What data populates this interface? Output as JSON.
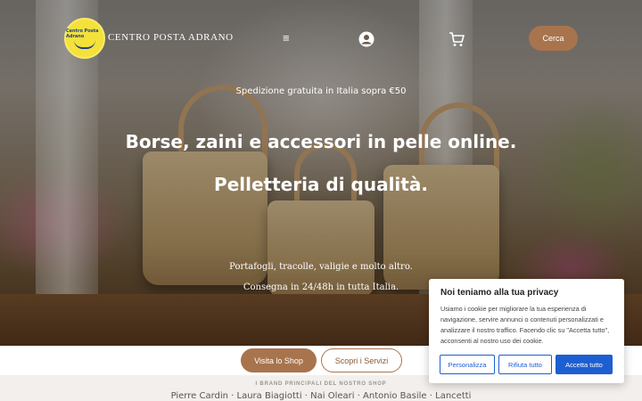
{
  "header": {
    "logo_text": "Centro Posta Adrano",
    "brand_name": "CENTRO POSTA ADRANO",
    "menu_icon": "menu-icon",
    "user_icon": "user-icon",
    "cart_icon": "cart-icon",
    "search_label": "Cerca"
  },
  "hero": {
    "promo": "Spedizione gratuita in Italia sopra €50",
    "headline_1": "Borse, zaini e accessori in pelle online.",
    "headline_2": "Pelletteria di qualità.",
    "sub_1": "Portafogli, tracolle, valigie e molto altro.",
    "sub_2": "Consegna in 24/48h in tutta Italia."
  },
  "cta": {
    "visit_label": "Visita lo Shop",
    "services_label": "Scopri i Servizi"
  },
  "brands": {
    "label": "I BRAND PRINCIPALI DEL NOSTRO SHOP",
    "list": "Pierre Cardin · Laura Biagiotti · Nai Oleari · Antonio Basile · Lancetti"
  },
  "cookie_banner": {
    "title": "Noi teniamo alla tua privacy",
    "text": "Usiamo i cookie per migliorare la tua esperienza di navigazione, servire annunci o contenuti personalizzati e analizzare il nostro traffico. Facendo clic su \"Accetta tutto\", acconsenti al nostro uso dei cookie.",
    "customize_label": "Personalizza",
    "reject_label": "Rifiuta tutto",
    "accept_label": "Accetta tutto"
  },
  "colors": {
    "accent_brown": "#a8744d",
    "cookie_blue": "#1d5fd1",
    "logo_yellow": "#f4e13a"
  }
}
